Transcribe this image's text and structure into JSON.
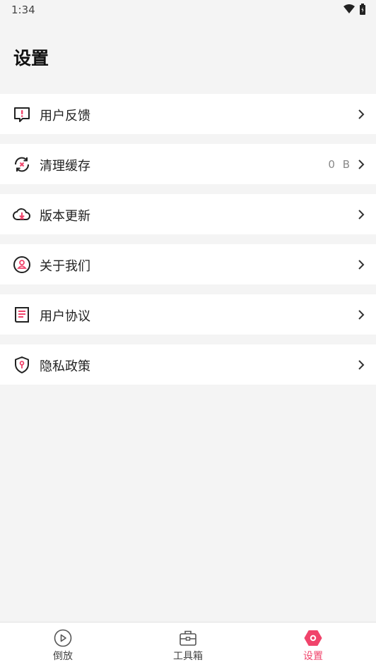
{
  "status": {
    "time": "1:34"
  },
  "page": {
    "title": "设置"
  },
  "menu": [
    {
      "label": "用户反馈",
      "icon": "feedback-icon",
      "value": ""
    },
    {
      "label": "清理缓存",
      "icon": "cache-clear-icon",
      "value": "0 B"
    },
    {
      "label": "版本更新",
      "icon": "cloud-download-icon",
      "value": ""
    },
    {
      "label": "关于我们",
      "icon": "person-icon",
      "value": ""
    },
    {
      "label": "用户协议",
      "icon": "document-icon",
      "value": ""
    },
    {
      "label": "隐私政策",
      "icon": "shield-icon",
      "value": ""
    }
  ],
  "tabs": [
    {
      "label": "倒放",
      "icon": "play-circle-icon",
      "active": false
    },
    {
      "label": "工具箱",
      "icon": "toolbox-icon",
      "active": false
    },
    {
      "label": "设置",
      "icon": "settings-hex-icon",
      "active": true
    }
  ],
  "colors": {
    "accent": "#f0446b",
    "background": "#f4f4f4"
  }
}
